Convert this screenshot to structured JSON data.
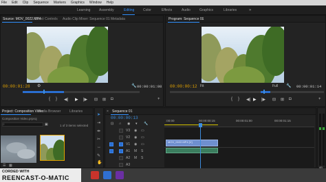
{
  "menubar": {
    "items": [
      "File",
      "Edit",
      "Clip",
      "Sequence",
      "Markers",
      "Graphics",
      "Window",
      "Help"
    ]
  },
  "workspace": {
    "tabs": [
      "Learning",
      "Assembly",
      "Editing",
      "Color",
      "Effects",
      "Audio",
      "Graphics",
      "Libraries"
    ],
    "active": "Editing",
    "more": "»",
    "accent": "#2f8fff"
  },
  "source": {
    "tabs": [
      "Source: MOV_0022.MP4",
      "Effect Controls",
      "Audio Clip Mixer: Sequence 01",
      "Metadata"
    ],
    "timecode_in": "00:00:01:28",
    "timecode_out": "00:00:01:08",
    "timecode_color": "#e2a200"
  },
  "program": {
    "tab": "Program: Sequence 01",
    "timecode_in": "00:00:00:12",
    "zoom": "Fit",
    "quality": "Full",
    "timecode_out": "00:00:01:14"
  },
  "project": {
    "tabs": [
      "Project: Composition Video",
      "Media Browser",
      "Libraries"
    ],
    "filename": "Composition Video.prproj",
    "selection_info": "1 of 3 items selected"
  },
  "timeline": {
    "tab": "Sequence 01",
    "timecode": "00:00:00:13",
    "ruler_labels": [
      ":00:00",
      "00:00:00:15",
      "00:00:01:00",
      "00:00:01:15"
    ],
    "video_tracks": [
      "V3",
      "V2",
      "V1"
    ],
    "audio_tracks": [
      "A1",
      "A2",
      "A3"
    ],
    "video_clip_label": "MOV_0022.MP4 [V]",
    "playhead_progress": 0.37,
    "timecode_color": "#3c8dde"
  },
  "meter": {
    "labels": [
      "0",
      "-12",
      "-24",
      "-36",
      "-48",
      "dB"
    ]
  },
  "watermark": {
    "line1": "CORDED WITH",
    "line2": "REENCAST-O-MATIC"
  },
  "icons": {
    "play": "▶",
    "step_back": "◀|",
    "step_fwd": "|▶",
    "stop": "■",
    "wrench": "wrench-icon",
    "camera": "camera-icon"
  }
}
